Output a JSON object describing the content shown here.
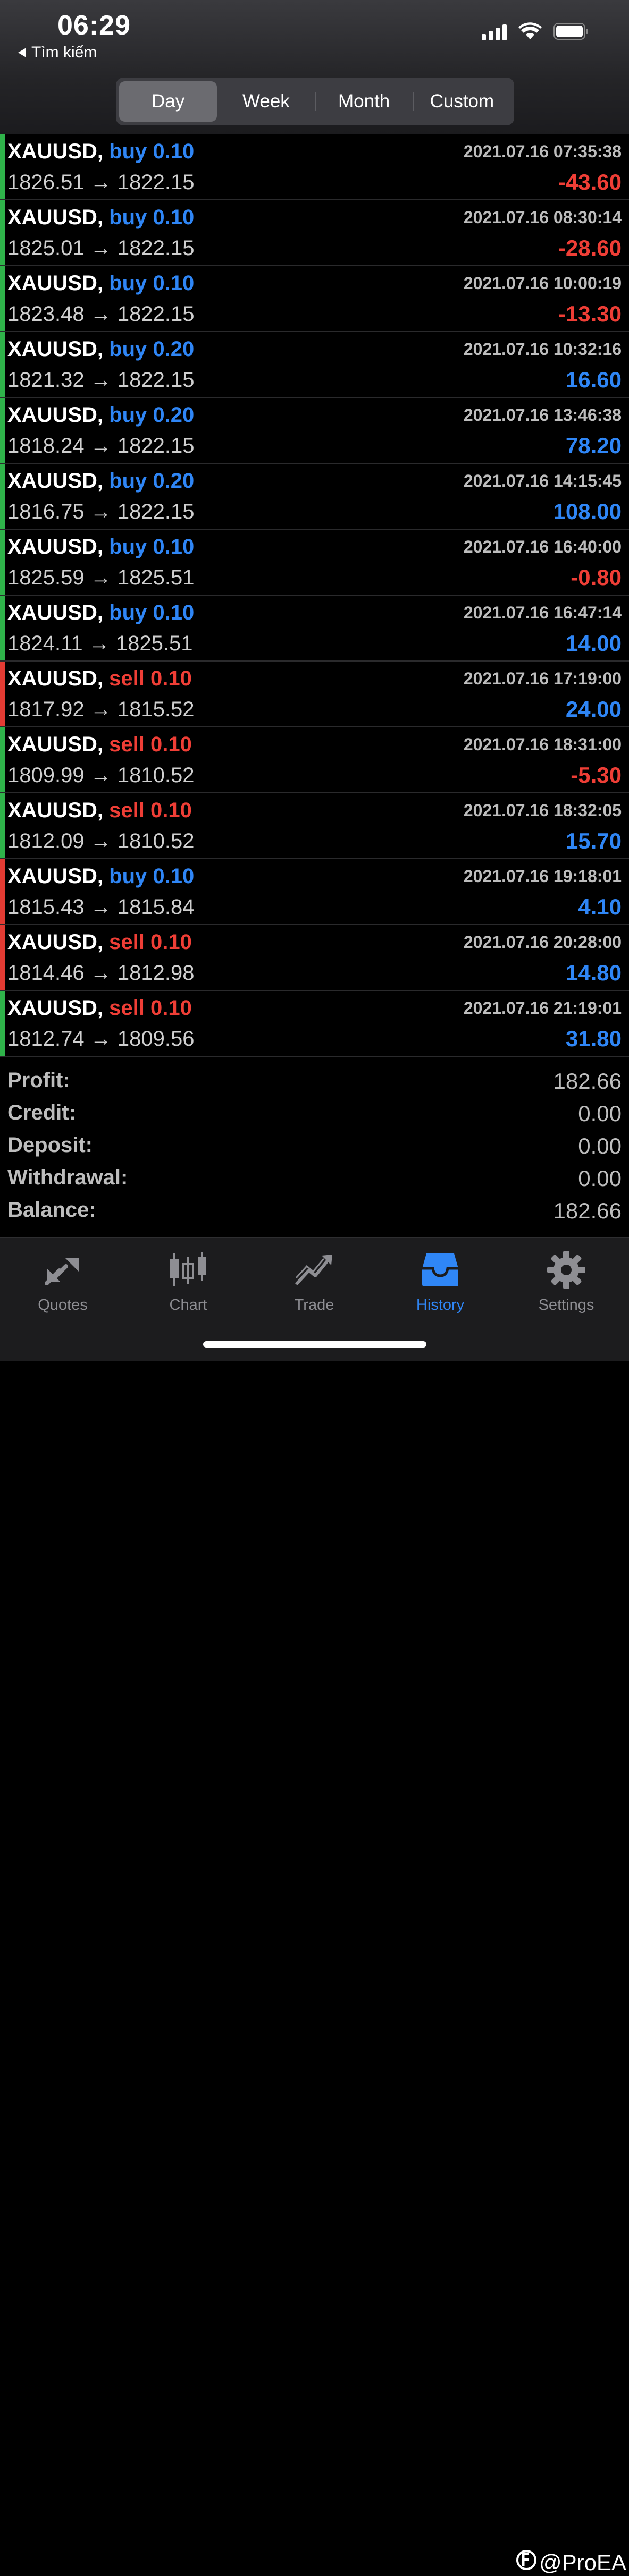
{
  "status_bar": {
    "time": "06:29",
    "back_label": "Tìm kiếm"
  },
  "period_tabs": [
    {
      "label": "Day",
      "active": true
    },
    {
      "label": "Week",
      "active": false
    },
    {
      "label": "Month",
      "active": false
    },
    {
      "label": "Custom",
      "active": false
    }
  ],
  "trades": [
    {
      "symbol": "XAUUSD,",
      "direction": "buy",
      "volume": "0.10",
      "open": "1826.51",
      "close": "1822.15",
      "arrow": "→",
      "datetime": "2021.07.16 07:35:38",
      "profit": "-43.60",
      "indicator_color": "#2fb34a"
    },
    {
      "symbol": "XAUUSD,",
      "direction": "buy",
      "volume": "0.10",
      "open": "1825.01",
      "close": "1822.15",
      "arrow": "→",
      "datetime": "2021.07.16 08:30:14",
      "profit": "-28.60",
      "indicator_color": "#2fb34a"
    },
    {
      "symbol": "XAUUSD,",
      "direction": "buy",
      "volume": "0.10",
      "open": "1823.48",
      "close": "1822.15",
      "arrow": "→",
      "datetime": "2021.07.16 10:00:19",
      "profit": "-13.30",
      "indicator_color": "#2fb34a"
    },
    {
      "symbol": "XAUUSD,",
      "direction": "buy",
      "volume": "0.20",
      "open": "1821.32",
      "close": "1822.15",
      "arrow": "→",
      "datetime": "2021.07.16 10:32:16",
      "profit": "16.60",
      "indicator_color": "#2fb34a"
    },
    {
      "symbol": "XAUUSD,",
      "direction": "buy",
      "volume": "0.20",
      "open": "1818.24",
      "close": "1822.15",
      "arrow": "→",
      "datetime": "2021.07.16 13:46:38",
      "profit": "78.20",
      "indicator_color": "#2fb34a"
    },
    {
      "symbol": "XAUUSD,",
      "direction": "buy",
      "volume": "0.20",
      "open": "1816.75",
      "close": "1822.15",
      "arrow": "→",
      "datetime": "2021.07.16 14:15:45",
      "profit": "108.00",
      "indicator_color": "#2fb34a"
    },
    {
      "symbol": "XAUUSD,",
      "direction": "buy",
      "volume": "0.10",
      "open": "1825.59",
      "close": "1825.51",
      "arrow": "→",
      "datetime": "2021.07.16 16:40:00",
      "profit": "-0.80",
      "indicator_color": "#2fb34a"
    },
    {
      "symbol": "XAUUSD,",
      "direction": "buy",
      "volume": "0.10",
      "open": "1824.11",
      "close": "1825.51",
      "arrow": "→",
      "datetime": "2021.07.16 16:47:14",
      "profit": "14.00",
      "indicator_color": "#2fb34a"
    },
    {
      "symbol": "XAUUSD,",
      "direction": "sell",
      "volume": "0.10",
      "open": "1817.92",
      "close": "1815.52",
      "arrow": "→",
      "datetime": "2021.07.16 17:19:00",
      "profit": "24.00",
      "indicator_color": "#e33b33"
    },
    {
      "symbol": "XAUUSD,",
      "direction": "sell",
      "volume": "0.10",
      "open": "1809.99",
      "close": "1810.52",
      "arrow": "→",
      "datetime": "2021.07.16 18:31:00",
      "profit": "-5.30",
      "indicator_color": "#2fb34a"
    },
    {
      "symbol": "XAUUSD,",
      "direction": "sell",
      "volume": "0.10",
      "open": "1812.09",
      "close": "1810.52",
      "arrow": "→",
      "datetime": "2021.07.16 18:32:05",
      "profit": "15.70",
      "indicator_color": "#2fb34a"
    },
    {
      "symbol": "XAUUSD,",
      "direction": "buy",
      "volume": "0.10",
      "open": "1815.43",
      "close": "1815.84",
      "arrow": "→",
      "datetime": "2021.07.16 19:18:01",
      "profit": "4.10",
      "indicator_color": "#e33b33"
    },
    {
      "symbol": "XAUUSD,",
      "direction": "sell",
      "volume": "0.10",
      "open": "1814.46",
      "close": "1812.98",
      "arrow": "→",
      "datetime": "2021.07.16 20:28:00",
      "profit": "14.80",
      "indicator_color": "#e33b33"
    },
    {
      "symbol": "XAUUSD,",
      "direction": "sell",
      "volume": "0.10",
      "open": "1812.74",
      "close": "1809.56",
      "arrow": "→",
      "datetime": "2021.07.16 21:19:01",
      "profit": "31.80",
      "indicator_color": "#2fb34a"
    }
  ],
  "summary": [
    {
      "label": "Profit:",
      "value": "182.66"
    },
    {
      "label": "Credit:",
      "value": "0.00"
    },
    {
      "label": "Deposit:",
      "value": "0.00"
    },
    {
      "label": "Withdrawal:",
      "value": "0.00"
    },
    {
      "label": "Balance:",
      "value": "182.66"
    }
  ],
  "tabbar": [
    {
      "label": "Quotes",
      "icon": "quotes-icon",
      "active": false
    },
    {
      "label": "Chart",
      "icon": "chart-icon",
      "active": false
    },
    {
      "label": "Trade",
      "icon": "trade-icon",
      "active": false
    },
    {
      "label": "History",
      "icon": "history-icon",
      "active": true
    },
    {
      "label": "Settings",
      "icon": "gear-icon",
      "active": false
    }
  ],
  "watermark": "@ProEA",
  "colors": {
    "buy": "#2f86f6",
    "sell": "#ef3e36",
    "positive": "#2f86f6",
    "negative": "#ef3e36",
    "active_tab": "#2f86f6",
    "inactive_tab": "#8e8e93"
  }
}
